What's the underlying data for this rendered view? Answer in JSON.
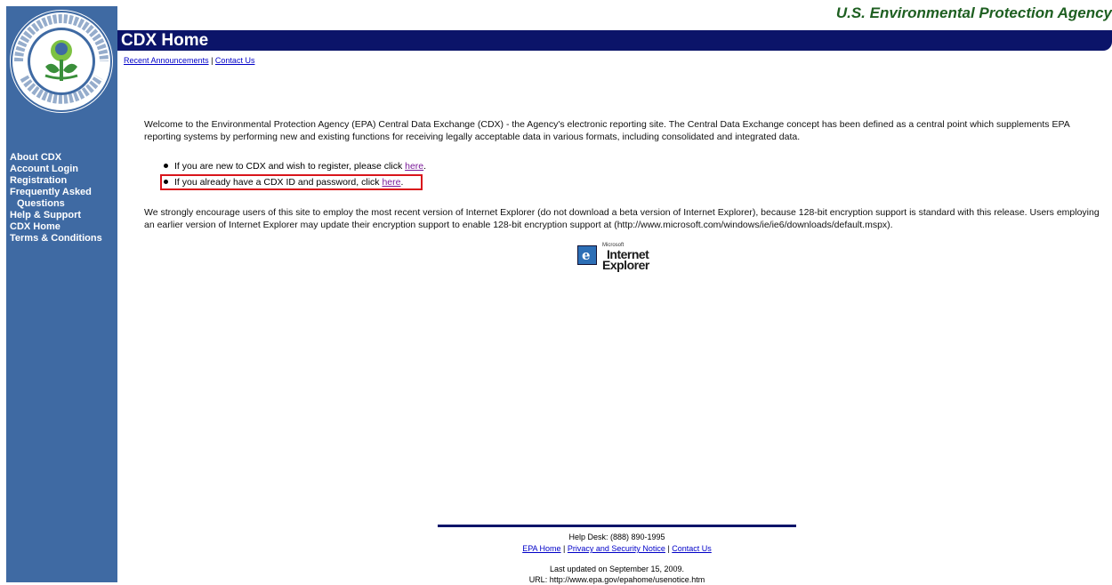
{
  "header": {
    "agency_name": "U.S. Environmental Protection Agency",
    "page_title": "CDX Home",
    "brand_color": "#0b1469",
    "sidebar_color": "#3f6aa3"
  },
  "logo": {
    "icon": "epa-seal-logo"
  },
  "sidebar": {
    "items": [
      {
        "label": "About CDX"
      },
      {
        "label": "Account Login"
      },
      {
        "label": "Registration"
      },
      {
        "label": "Frequently Asked"
      },
      {
        "label": "Questions"
      },
      {
        "label": "Help & Support"
      },
      {
        "label": "CDX Home"
      },
      {
        "label": "Terms & Conditions"
      }
    ]
  },
  "top_links": {
    "announcements": "Recent Announcements",
    "separator": " | ",
    "contact": "Contact Us"
  },
  "content": {
    "welcome": "Welcome to the Environmental Protection Agency (EPA) Central Data Exchange (CDX) - the Agency's electronic reporting site. The Central Data Exchange concept has been defined as a central point which supplements EPA reporting systems by performing new and existing functions for receiving legally acceptable data in various formats, including consolidated and integrated data.",
    "bullet_register_text": "If you are new to CDX and wish to register, please click ",
    "bullet_register_link": "here",
    "bullet_login_text": "If you already have a CDX ID and password, click ",
    "bullet_login_link": "here",
    "period": ".",
    "encourage": "We strongly encourage users of this site to employ the most recent version of Internet Explorer (do not download a beta version of Internet Explorer), because 128-bit encryption support is standard with this release. Users employing an earlier version of Internet Explorer may update their encryption support to enable 128-bit encryption support at (http://www.microsoft.com/windows/ie/ie6/downloads/default.mspx).",
    "highlight_color": "#d9151b"
  },
  "ie_badge": {
    "icon": "internet-explorer-logo",
    "small": "Microsoft",
    "line1": "Internet",
    "line2": "Explorer",
    "glyph": "e"
  },
  "footer": {
    "helpdesk": "Help Desk: (888) 890-1995",
    "epa_home": "EPA Home",
    "privacy": "Privacy and Security Notice",
    "contact": "Contact Us",
    "separator": " | ",
    "updated": "Last updated on September 15, 2009.",
    "url": "URL: http://www.epa.gov/epahome/usenotice.htm"
  }
}
